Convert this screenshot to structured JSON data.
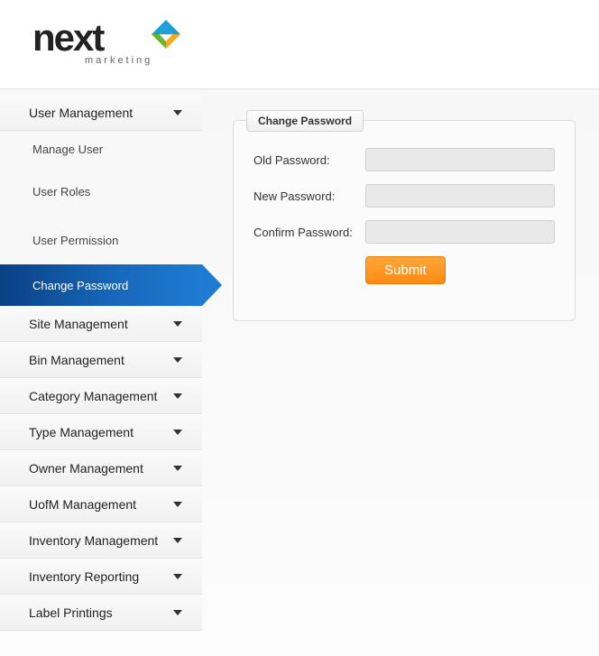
{
  "brand": {
    "name": "next",
    "tagline": "marketing"
  },
  "sidebar": {
    "sections": [
      {
        "label": "User Management"
      },
      {
        "label": "Site Management"
      },
      {
        "label": "Bin Management"
      },
      {
        "label": "Category Management"
      },
      {
        "label": "Type Management"
      },
      {
        "label": "Owner Management"
      },
      {
        "label": "UofM Management"
      },
      {
        "label": "Inventory Management"
      },
      {
        "label": "Inventory Reporting"
      },
      {
        "label": "Label Printings"
      }
    ],
    "user_mgmt_items": [
      {
        "label": "Manage User"
      },
      {
        "label": "User Roles"
      },
      {
        "label": "User Permission"
      },
      {
        "label": "Change Password"
      }
    ]
  },
  "panel": {
    "title": "Change Password",
    "fields": {
      "old": "Old Password:",
      "new": "New Password:",
      "confirm": "Confirm Password:"
    },
    "submit": "Submit"
  }
}
